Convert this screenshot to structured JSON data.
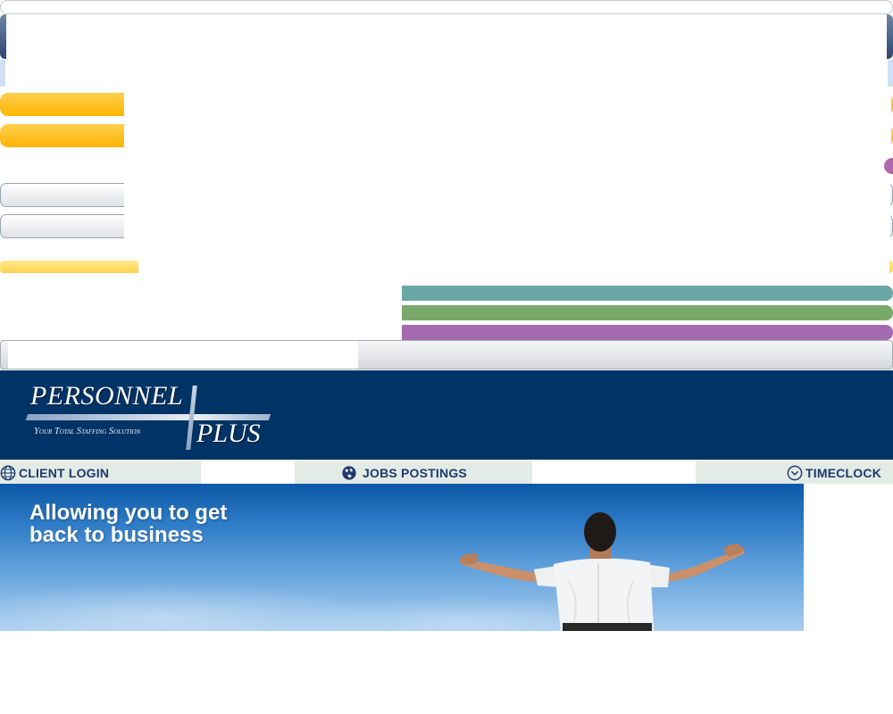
{
  "logo": {
    "word_primary": "PERSONNEL",
    "word_secondary": "PLUS",
    "tagline": "Your Total Staffing Solution"
  },
  "nav": {
    "client_login": "CLIENT LOGIN",
    "jobs_postings": "JOBS POSTINGS",
    "timeclock": "TIMECLOCK"
  },
  "hero": {
    "headline_line1": "Allowing you to get",
    "headline_line2": "back to business"
  },
  "icons": {
    "client_login": "globe-icon",
    "jobs_postings": "world-icon",
    "timeclock": "clock-icon"
  },
  "colors": {
    "header_bg": "#003366",
    "nav_bg": "#e3ebe6",
    "nav_text": "#1e3a6e"
  }
}
